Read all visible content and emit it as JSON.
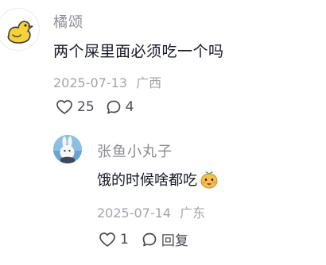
{
  "comment": {
    "username": "橘颂",
    "text": "两个屎里面必须吃一个吗",
    "date": "2025-07-13",
    "location": "广西",
    "like_count": "25",
    "reply_count": "4",
    "avatar_icon": "yellow-duck-icon"
  },
  "reply": {
    "username": "张鱼小丸子",
    "text": "饿的时候啥都吃",
    "emoji_icon": "drooling-face-emoji-icon",
    "date": "2025-07-14",
    "location": "广东",
    "like_count": "1",
    "reply_label": "回复",
    "avatar_icon": "rabbit-photo-avatar"
  },
  "colors": {
    "username": "#8a8b91",
    "text": "#161823",
    "meta": "#a3a4a8",
    "action": "#4a4b52"
  }
}
